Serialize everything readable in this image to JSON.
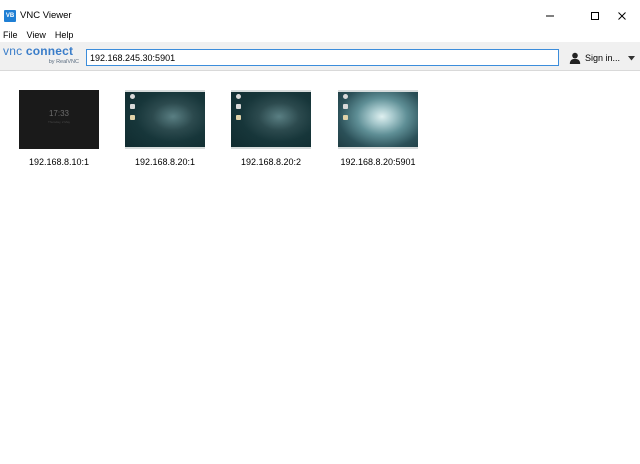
{
  "window": {
    "icon_text": "VB",
    "title": "VNC Viewer"
  },
  "menu": [
    "File",
    "View",
    "Help"
  ],
  "toolbar": {
    "logo_vnc": "vnc",
    "logo_connect": "connect",
    "logo_sub": "by RealVNC",
    "address_value": "192.168.245.30:5901",
    "signin_label": "Sign in..."
  },
  "connections": [
    {
      "label": "192.168.8.10:1",
      "thumb": "lock-screen",
      "clock": "17:33",
      "clock_sub": "Thursday, 2 May"
    },
    {
      "label": "192.168.8.20:1",
      "thumb": "desktop"
    },
    {
      "label": "192.168.8.20:2",
      "thumb": "desktop"
    },
    {
      "label": "192.168.8.20:5901",
      "thumb": "desktop-bright"
    }
  ],
  "colors": {
    "accent": "#3c8ddb",
    "logo": "#3a7dc9",
    "app_icon": "#1f7fd4"
  }
}
